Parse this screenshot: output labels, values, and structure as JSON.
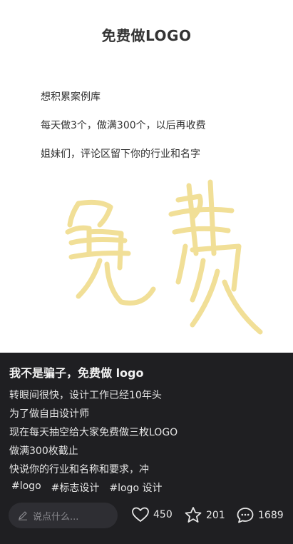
{
  "image": {
    "title": "免费做LOGO",
    "lines": [
      "想积累案例库",
      "每天做3个，做满300个，以后再收费",
      "姐妹们，评论区留下你的行业和名字"
    ],
    "handwriting_text": "免费",
    "handwriting_color": "#f0dc8c"
  },
  "post": {
    "title": "我不是骗子，免费做 logo",
    "lines": [
      "转眼间很快，设计工作已经10年头",
      "为了做自由设计师",
      "现在每天抽空给大家免费做三枚LOGO",
      "做满300枚截止",
      "快说你的行业和名称和要求，冲"
    ],
    "tags": [
      "#logo",
      "#标志设计",
      "#logo 设计"
    ]
  },
  "actions": {
    "comment_placeholder": "说点什么...",
    "likes": "450",
    "favorites": "201",
    "comments": "1689"
  },
  "colors": {
    "dark_background": "#1f1f22",
    "input_background": "#2e2e33"
  },
  "icons": {
    "comment_input": "pen-icon",
    "like": "heart-icon",
    "favorite": "star-icon",
    "comments": "chat-bubble-icon"
  }
}
